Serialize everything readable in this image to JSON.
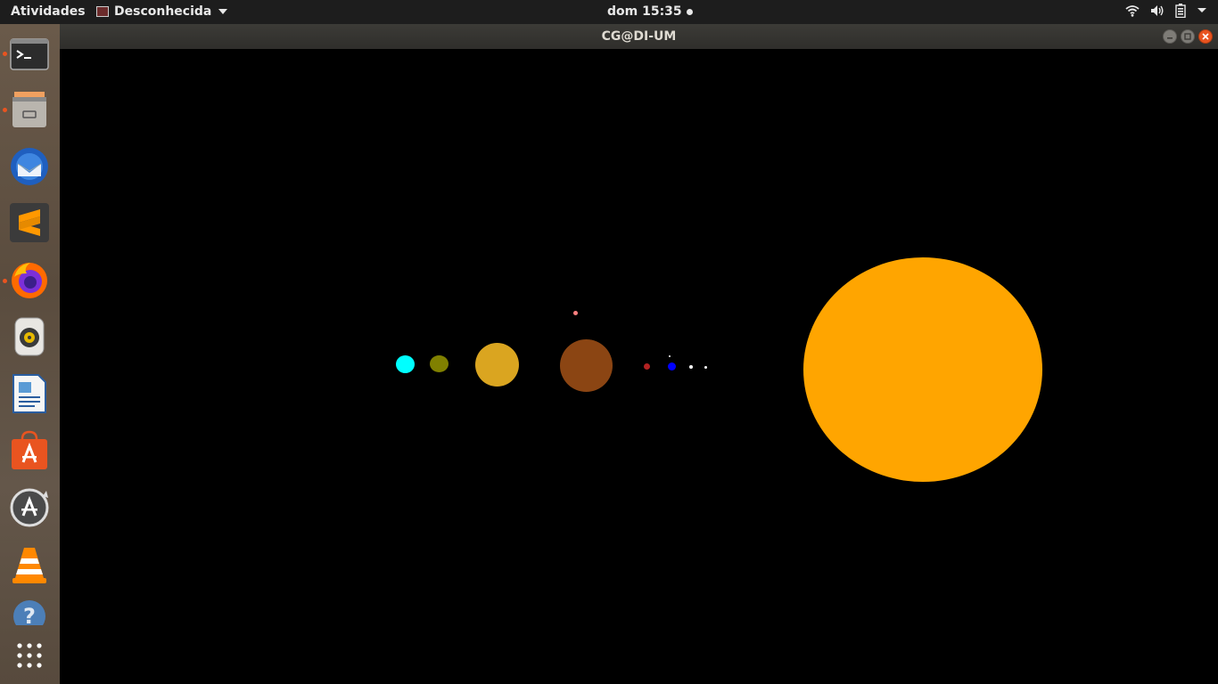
{
  "topbar": {
    "activities": "Atividades",
    "app_menu": "Desconhecida",
    "clock": "dom 15:35",
    "tray_icons": [
      "wifi-icon",
      "volume-icon",
      "battery-icon",
      "system-menu-caret-icon"
    ]
  },
  "dock": {
    "items": [
      {
        "name": "terminal",
        "running": true
      },
      {
        "name": "files",
        "running": true
      },
      {
        "name": "thunderbird",
        "running": false
      },
      {
        "name": "sublime-text",
        "running": false
      },
      {
        "name": "firefox",
        "running": true
      },
      {
        "name": "rhythmbox",
        "running": false
      },
      {
        "name": "libreoffice-writer",
        "running": false
      },
      {
        "name": "ubuntu-software",
        "running": false
      },
      {
        "name": "software-updater",
        "running": false
      },
      {
        "name": "vlc",
        "running": false
      },
      {
        "name": "help",
        "running": false
      },
      {
        "name": "show-applications",
        "running": false
      }
    ]
  },
  "window": {
    "title": "CG@DI-UM"
  },
  "scene": {
    "bodies": [
      {
        "name": "sun",
        "color": "#ffa500"
      },
      {
        "name": "mercury",
        "color": "#ffffff"
      },
      {
        "name": "venus",
        "color": "#ffffff"
      },
      {
        "name": "earth",
        "color": "#0000ff"
      },
      {
        "name": "moon",
        "color": "#ffffff"
      },
      {
        "name": "mars",
        "color": "#b22222"
      },
      {
        "name": "jupiter",
        "color": "#8b4513"
      },
      {
        "name": "jupiter-moon",
        "color": "#ff8080"
      },
      {
        "name": "saturn",
        "color": "#daa520"
      },
      {
        "name": "uranus",
        "color": "#808000"
      },
      {
        "name": "neptune",
        "color": "#00ffff"
      }
    ]
  }
}
